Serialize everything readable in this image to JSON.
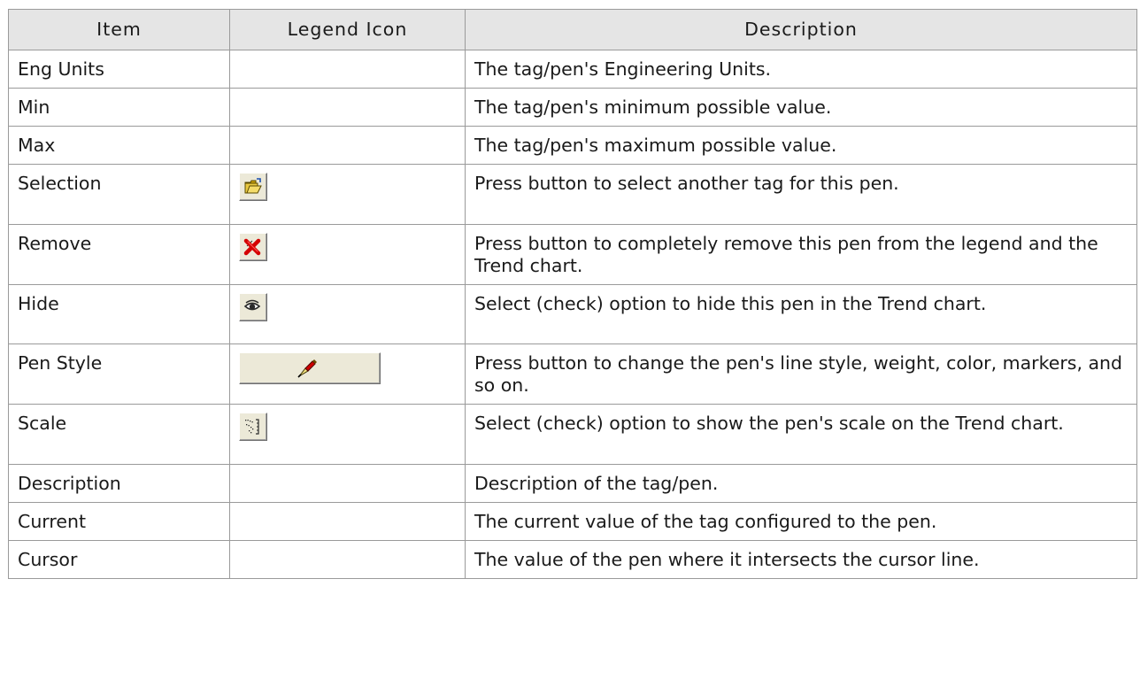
{
  "table": {
    "headers": [
      "Item",
      "Legend Icon",
      "Description"
    ],
    "rows": [
      {
        "item": "Eng Units",
        "icon": "",
        "description": "The tag/pen's Engineering Units."
      },
      {
        "item": "Min",
        "icon": "",
        "description": "The tag/pen's minimum possible value."
      },
      {
        "item": "Max",
        "icon": "",
        "description": "The tag/pen's maximum possible value."
      },
      {
        "item": "Selection",
        "icon": "open-folder-icon",
        "description": "Press button to select another tag for this pen."
      },
      {
        "item": "Remove",
        "icon": "red-x-delete-icon",
        "description": "Press button to completely remove this pen from the legend and the Trend chart."
      },
      {
        "item": "Hide",
        "icon": "eye-icon",
        "description": "Select (check) option to hide this pen in the Trend chart."
      },
      {
        "item": "Pen Style",
        "icon": "pen-brush-icon",
        "description": "Press button to change the pen's line style, weight, color, markers, and so on."
      },
      {
        "item": "Scale",
        "icon": "scale-icon",
        "description": "Select (check) option to show the pen's scale on the Trend chart."
      },
      {
        "item": "Description",
        "icon": "",
        "description": "Description of the tag/pen."
      },
      {
        "item": "Current",
        "icon": "",
        "description": "The current value of the tag configured to the pen."
      },
      {
        "item": "Cursor",
        "icon": "",
        "description": "The value of the pen where it intersects the cursor line."
      }
    ]
  }
}
